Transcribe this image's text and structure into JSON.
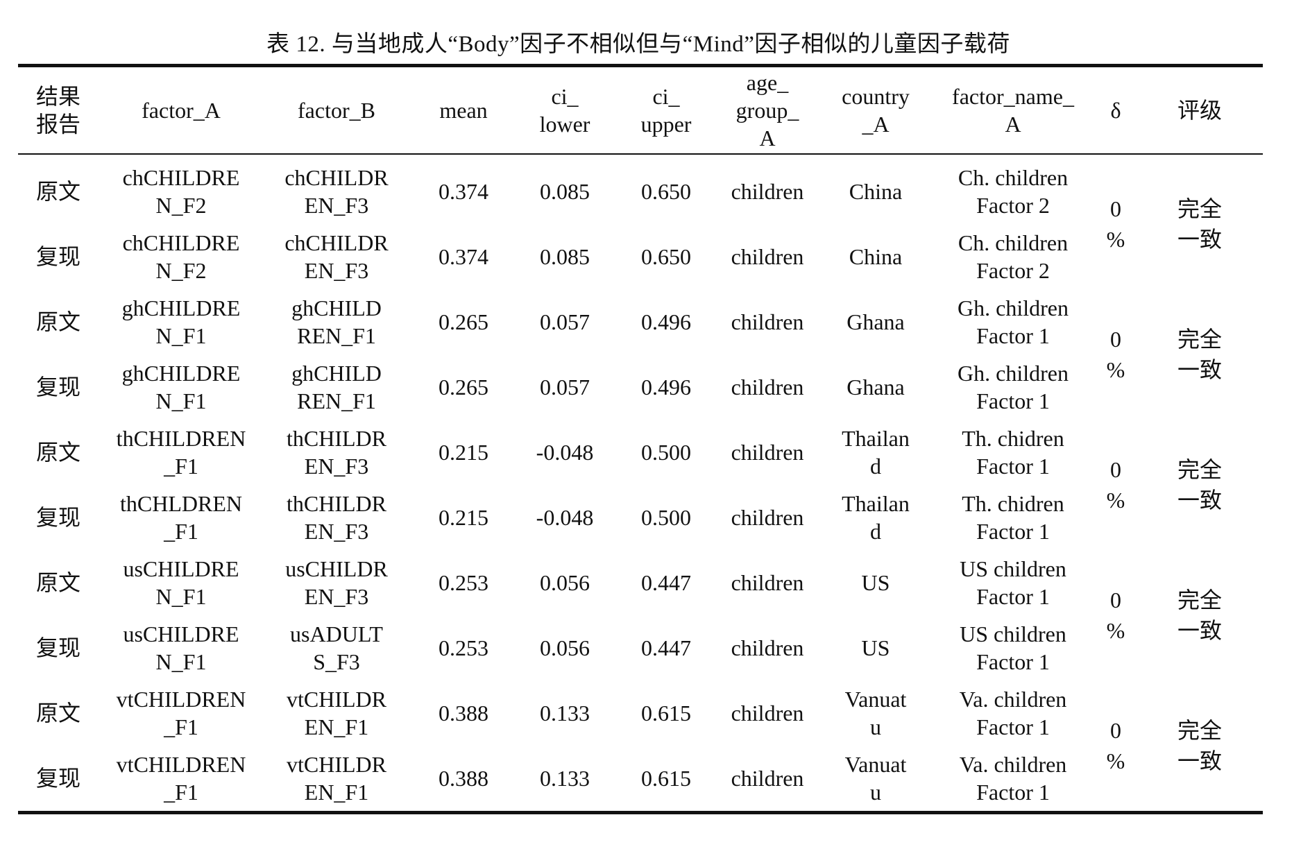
{
  "caption": "表 12. 与当地成人“Body”因子不相似但与“Mind”因子相似的儿童因子载荷",
  "columns": [
    "结果\n报告",
    "factor_A",
    "factor_B",
    "mean",
    "ci_\nlower",
    "ci_\nupper",
    "age_\ngroup_\nA",
    "country\n_A",
    "factor_name_\nA",
    "δ",
    "评级"
  ],
  "rows": [
    {
      "label": "原文",
      "factor_A": "chCHILDRE\nN_F2",
      "factor_B": "chCHILDR\nEN_F3",
      "mean": "0.374",
      "ci_lower": "0.085",
      "ci_upper": "0.650",
      "age_group": "children",
      "country": "China",
      "factor_name": "Ch. children\nFactor 2"
    },
    {
      "label": "复现",
      "factor_A": "chCHILDRE\nN_F2",
      "factor_B": "chCHILDR\nEN_F3",
      "mean": "0.374",
      "ci_lower": "0.085",
      "ci_upper": "0.650",
      "age_group": "children",
      "country": "China",
      "factor_name": "Ch. children\nFactor 2"
    },
    {
      "label": "原文",
      "factor_A": "ghCHILDRE\nN_F1",
      "factor_B": "ghCHILD\nREN_F1",
      "mean": "0.265",
      "ci_lower": "0.057",
      "ci_upper": "0.496",
      "age_group": "children",
      "country": "Ghana",
      "factor_name": "Gh. children\nFactor 1"
    },
    {
      "label": "复现",
      "factor_A": "ghCHILDRE\nN_F1",
      "factor_B": "ghCHILD\nREN_F1",
      "mean": "0.265",
      "ci_lower": "0.057",
      "ci_upper": "0.496",
      "age_group": "children",
      "country": "Ghana",
      "factor_name": "Gh. children\nFactor 1"
    },
    {
      "label": "原文",
      "factor_A": "thCHILDREN\n_F1",
      "factor_B": "thCHILDR\nEN_F3",
      "mean": "0.215",
      "ci_lower": "-0.048",
      "ci_upper": "0.500",
      "age_group": "children",
      "country": "Thailan\nd",
      "factor_name": "Th. chidren\nFactor 1"
    },
    {
      "label": "复现",
      "factor_A": "thCHLDREN\n_F1",
      "factor_B": "thCHILDR\nEN_F3",
      "mean": "0.215",
      "ci_lower": "-0.048",
      "ci_upper": "0.500",
      "age_group": "children",
      "country": "Thailan\nd",
      "factor_name": "Th. chidren\nFactor 1"
    },
    {
      "label": "原文",
      "factor_A": "usCHILDRE\nN_F1",
      "factor_B": "usCHILDR\nEN_F3",
      "mean": "0.253",
      "ci_lower": "0.056",
      "ci_upper": "0.447",
      "age_group": "children",
      "country": "US",
      "factor_name": "US children\nFactor 1"
    },
    {
      "label": "复现",
      "factor_A": "usCHILDRE\nN_F1",
      "factor_B": "usADULT\nS_F3",
      "mean": "0.253",
      "ci_lower": "0.056",
      "ci_upper": "0.447",
      "age_group": "children",
      "country": "US",
      "factor_name": "US children\nFactor 1"
    },
    {
      "label": "原文",
      "factor_A": "vtCHILDREN\n_F1",
      "factor_B": "vtCHILDR\nEN_F1",
      "mean": "0.388",
      "ci_lower": "0.133",
      "ci_upper": "0.615",
      "age_group": "children",
      "country": "Vanuat\nu",
      "factor_name": "Va. children\nFactor 1"
    },
    {
      "label": "复现",
      "factor_A": "vtCHILDREN\n_F1",
      "factor_B": "vtCHILDR\nEN_F1",
      "mean": "0.388",
      "ci_lower": "0.133",
      "ci_upper": "0.615",
      "age_group": "children",
      "country": "Vanuat\nu",
      "factor_name": "Va. children\nFactor 1"
    }
  ],
  "groups": [
    {
      "delta": "0\n%",
      "grade": "完全\n一致"
    },
    {
      "delta": "0\n%",
      "grade": "完全\n一致"
    },
    {
      "delta": "0\n%",
      "grade": "完全\n一致"
    },
    {
      "delta": "0\n%",
      "grade": "完全\n一致"
    },
    {
      "delta": "0\n%",
      "grade": "完全\n一致"
    }
  ]
}
